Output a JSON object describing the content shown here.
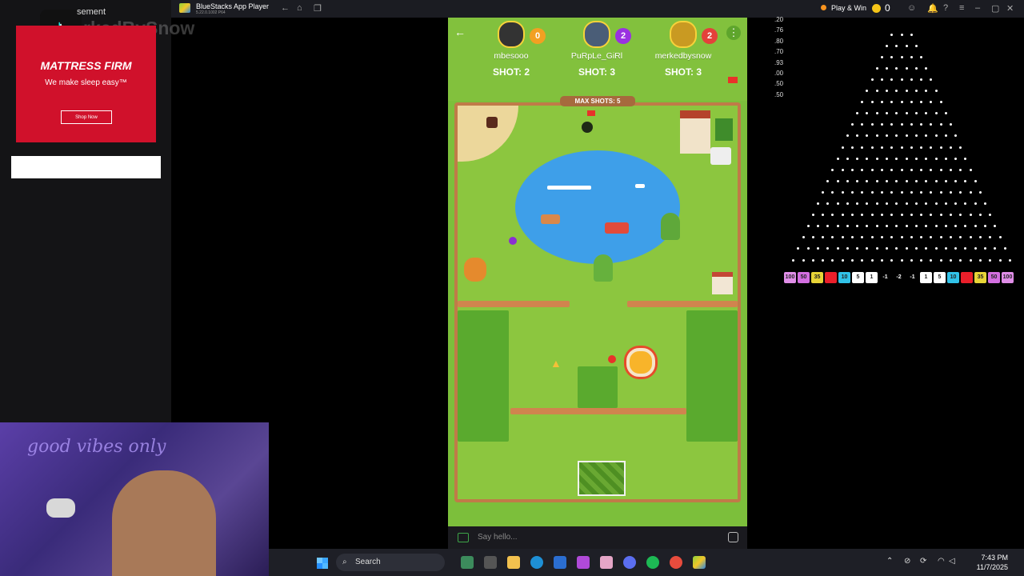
{
  "stream_overlay": {
    "ad_label": "sement",
    "watermark": "rkedBySnow",
    "ad": {
      "brand": "MATTRESS FIRM",
      "tagline": "We make sleep easy™",
      "button": "Shop Now"
    },
    "webcam_sign": "good vibes only"
  },
  "window": {
    "title": "BlueStacks App Player",
    "version": "5.22.0.1002 P64",
    "play_win": "Play & Win",
    "coins": "0"
  },
  "game": {
    "players": [
      {
        "name": "mbesooo",
        "score": "0",
        "badge_color": "#f2a022",
        "shot": "SHOT: 2"
      },
      {
        "name": "PuRpLe_GiRl",
        "score": "2",
        "badge_color": "#9a32e0",
        "shot": "SHOT: 3"
      },
      {
        "name": "merkedbysnow",
        "score": "2",
        "badge_color": "#e4413a",
        "shot": "SHOT: 3"
      }
    ],
    "max_shots": "MAX SHOTS: 5",
    "chat_placeholder": "Say hello..."
  },
  "plinko": {
    "odds": [
      ".20",
      ".76",
      ".80",
      ".70",
      ".93",
      ".00",
      ".50",
      ".50"
    ],
    "slots": [
      {
        "label": "100",
        "color": "#e08ee8"
      },
      {
        "label": "50",
        "color": "#d26ee0"
      },
      {
        "label": "35",
        "color": "#e7d437"
      },
      {
        "label": "",
        "color": "#ea1f2a"
      },
      {
        "label": "10",
        "color": "#31c2e8"
      },
      {
        "label": "5",
        "color": "#ffffff"
      },
      {
        "label": "1",
        "color": "#ffffff"
      },
      {
        "label": "-1",
        "color": "#000000"
      },
      {
        "label": "-2",
        "color": "#000000"
      },
      {
        "label": "-1",
        "color": "#000000"
      },
      {
        "label": "1",
        "color": "#ffffff"
      },
      {
        "label": "5",
        "color": "#ffffff"
      },
      {
        "label": "10",
        "color": "#31c2e8"
      },
      {
        "label": "",
        "color": "#ea1f2a"
      },
      {
        "label": "35",
        "color": "#e7d437"
      },
      {
        "label": "50",
        "color": "#d26ee0"
      },
      {
        "label": "100",
        "color": "#e08ee8"
      }
    ]
  },
  "taskbar": {
    "search": "Search",
    "time": "7:43 PM",
    "date": "11/7/2025"
  }
}
